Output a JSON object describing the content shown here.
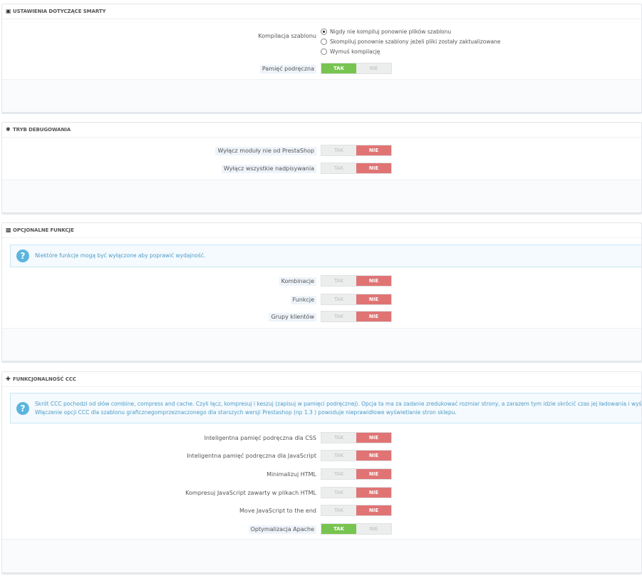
{
  "smarty": {
    "title": "USTAWIENIA DOTYCZĄCE SMARTY",
    "icon": "camera-icon",
    "compile_label": "Kompilacja szablonu",
    "compile_options": [
      "Nigdy nie kompiluj ponownie plików szablonu",
      "Skompiluj ponownie szablony jeżeli pliki zostały zaktualizowane",
      "Wymuś kompilację"
    ],
    "compile_selected": 0,
    "cache_label": "Pamięć podręczna",
    "cache_value": "yes"
  },
  "switch_labels": {
    "yes": "TAK",
    "no": "NIE"
  },
  "debug": {
    "title": "TRYB DEBUGOWANIA",
    "icon": "bug-icon",
    "rows": [
      {
        "label": "Wyłącz moduły nie od PrestaShop",
        "value": "no"
      },
      {
        "label": "Wyłącz wszystkie nadpisywania",
        "value": "no"
      }
    ]
  },
  "optional": {
    "title": "OPCJONALNE FUNKCJE",
    "icon": "puzzle-icon",
    "alert": "Niektóre funkcje mogą być wyłączone aby poprawić wydajność.",
    "rows": [
      {
        "label": "Kombinacje",
        "value": "no"
      },
      {
        "label": "Funkcje",
        "value": "no"
      },
      {
        "label": "Grupy klientów",
        "value": "no"
      }
    ]
  },
  "ccc": {
    "title": "FUNKCJONALNOŚĆ CCC",
    "icon": "fullscreen-icon",
    "alert_line1": "Skrót CCC pochodzi od słów combine, compress and cache. Czyli łącz, kompresuj i keszuj (zapisuj w pamięci podręcznej). Opcja ta ma za zadanie zredukować rozmiar strony, a zarazem tym idzie skrócić czas jej ładowania i wyświetlania poszczególnych elementów.",
    "alert_line2": "Włączenie opcji CCC dla szablonu graficznegomprzeznaczonego dla starszych wersji Prestashop (np 1.3 ) powoduje nieprawidłowe wyświetlanie stron sklepu.",
    "rows": [
      {
        "label": "Inteligentna pamięć podręczna dla CSS",
        "value": "no"
      },
      {
        "label": "Inteligentna pamięć podręczna dla JavaScript",
        "value": "no"
      },
      {
        "label": "Minimalizuj HTML",
        "value": "no"
      },
      {
        "label": "Kompresuj JavaScript zawarty w plikach HTML",
        "value": "no"
      },
      {
        "label": "Move JavaScript to the end",
        "value": "no"
      },
      {
        "label": "Optymalizacja Apache",
        "value": "yes"
      }
    ]
  }
}
